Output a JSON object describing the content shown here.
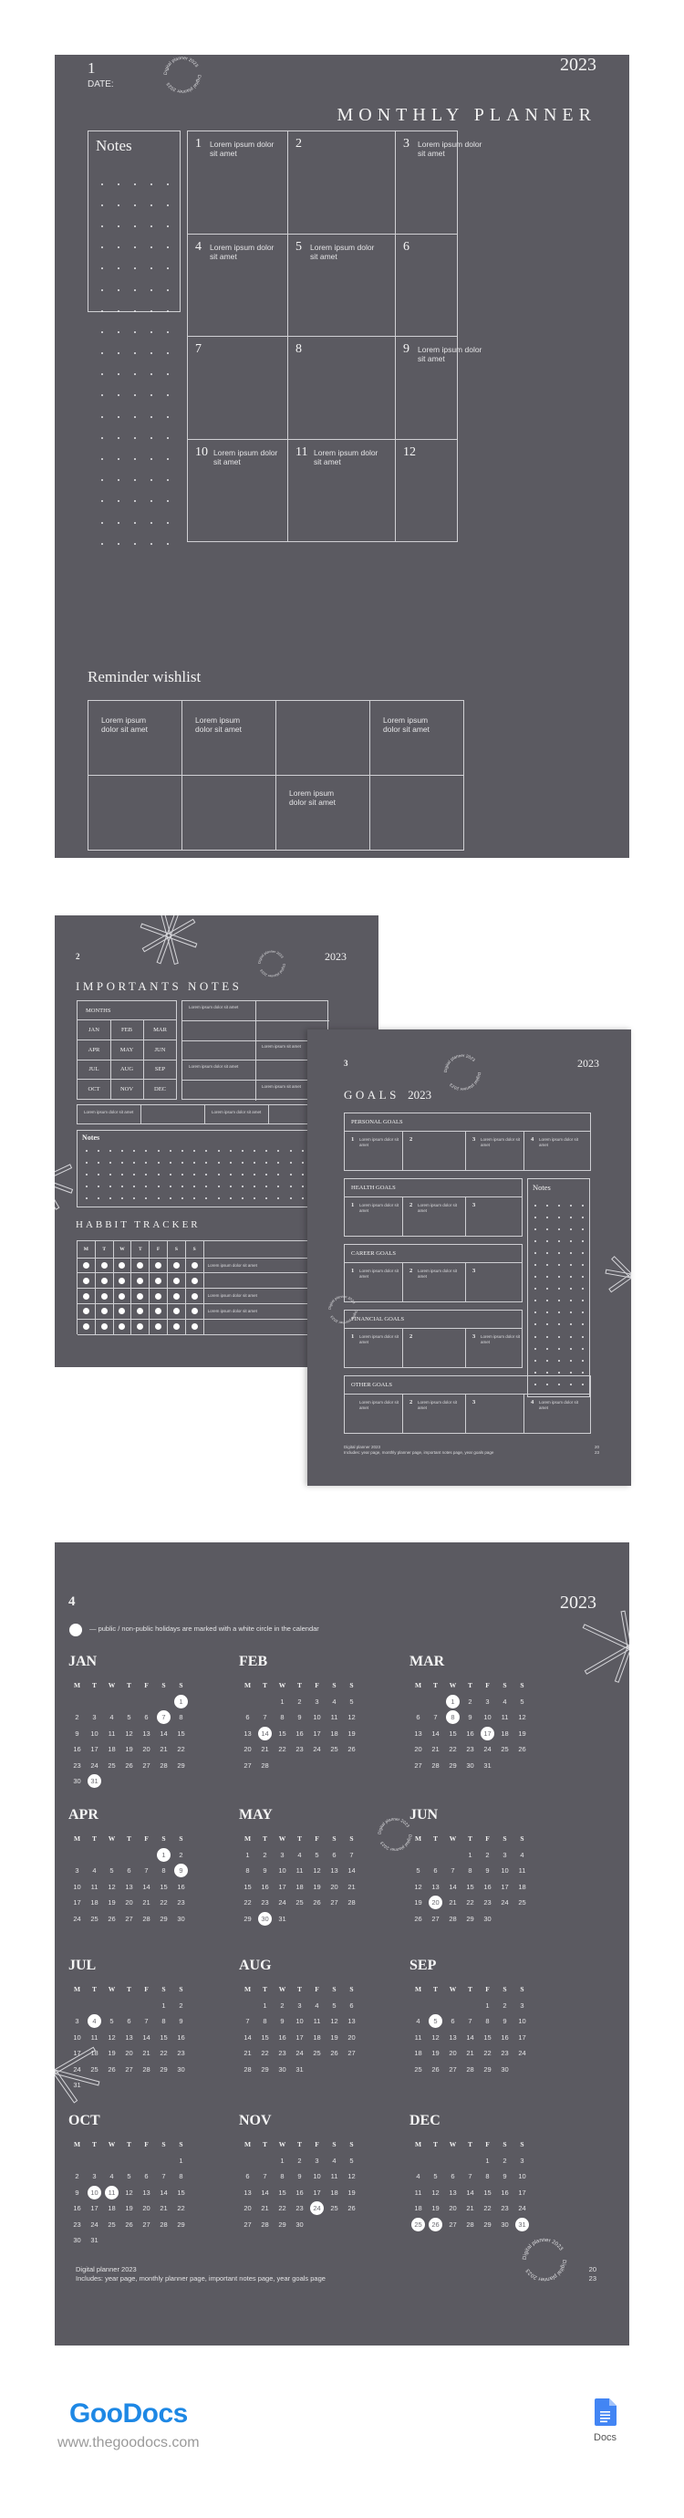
{
  "colors": {
    "page_bg": "#5b5a61",
    "line": "#d9d9dd",
    "text": "#f2f2f2",
    "holiday_circle": "#ffffff",
    "brand_blue": "#1e88e5",
    "docs_blue": "#4285f4"
  },
  "stamp_text": "Digital planner 2023",
  "lorem": "Lorem ipsum dolor sit amet",
  "page1": {
    "page_number": "1",
    "date_label": "DATE:",
    "year": "2023",
    "title": "MONTHLY PLANNER",
    "notes_title": "Notes",
    "months": [
      {
        "n": "1",
        "text": "Lorem ipsum dolor sit amet"
      },
      {
        "n": "2",
        "text": ""
      },
      {
        "n": "3",
        "text": "Lorem ipsum dolor sit amet"
      },
      {
        "n": "4",
        "text": "Lorem ipsum dolor sit amet"
      },
      {
        "n": "5",
        "text": "Lorem ipsum dolor sit amet"
      },
      {
        "n": "6",
        "text": ""
      },
      {
        "n": "7",
        "text": ""
      },
      {
        "n": "8",
        "text": ""
      },
      {
        "n": "9",
        "text": "Lorem ipsum dolor sit amet"
      },
      {
        "n": "10",
        "text": "Lorem ipsum dolor sit amet"
      },
      {
        "n": "11",
        "text": "Lorem ipsum dolor sit amet"
      },
      {
        "n": "12",
        "text": ""
      }
    ],
    "reminder_title": "Reminder wishlist",
    "reminders": [
      "Lorem ipsum dolor sit amet",
      "Lorem ipsum dolor sit amet",
      "",
      "Lorem ipsum dolor sit amet",
      "",
      "",
      "Lorem ipsum dolor sit amet",
      ""
    ]
  },
  "page2": {
    "page_number": "2",
    "year": "2023",
    "title": "IMPORTANTS NOTES",
    "months_header": "MONTHS",
    "months": [
      "JAN",
      "FEB",
      "MAR",
      "APR",
      "MAY",
      "JUN",
      "JUL",
      "AUG",
      "SEP",
      "OCT",
      "NOV",
      "DEC"
    ],
    "side_notes": [
      "Lorem ipsum dolor sit amet",
      "",
      "",
      "",
      "",
      "Lorem ipsum sit amet",
      "Lorem ipsum dolor sit amet",
      "",
      "",
      "Lorem ipsum sit amet"
    ],
    "bottom_notes": [
      "Lorem ipsum dolor sit amet",
      "",
      "Lorem ipsum dolor sit amet",
      ""
    ],
    "notes_title": "Notes",
    "habit_title": "HABBIT TRACKER",
    "habit_days": [
      "M",
      "T",
      "W",
      "T",
      "F",
      "S",
      "S"
    ],
    "habit_rows": [
      "Lorem ipsum dolor sit amet",
      "",
      "Lorem ipsum dolor sit amet",
      "Lorem ipsum dolor sit amet",
      ""
    ]
  },
  "page3": {
    "page_number": "3",
    "year": "2023",
    "title": "GOALS",
    "title_year": "2023",
    "notes_title": "Notes",
    "sections": [
      {
        "title": "PERSONAL GOALS",
        "items": [
          {
            "n": "1",
            "text": "Lorem ipsum dolor sit amet"
          },
          {
            "n": "2",
            "text": ""
          },
          {
            "n": "3",
            "text": "Lorem ipsum dolor sit amet"
          },
          {
            "n": "4",
            "text": "Lorem ipsum dolor sit amet"
          }
        ]
      },
      {
        "title": "HEALTH GOALS",
        "items": [
          {
            "n": "1",
            "text": "Lorem ipsum dolor sit amet"
          },
          {
            "n": "2",
            "text": "Lorem ipsum dolor sit amet"
          },
          {
            "n": "3",
            "text": ""
          }
        ]
      },
      {
        "title": "CAREER GOALS",
        "items": [
          {
            "n": "1",
            "text": "Lorem ipsum dolor sit amet"
          },
          {
            "n": "2",
            "text": "Lorem ipsum dolor sit amet"
          },
          {
            "n": "3",
            "text": ""
          }
        ]
      },
      {
        "title": "FINANCIAL GOALS",
        "items": [
          {
            "n": "1",
            "text": "Lorem ipsum dolor sit amet"
          },
          {
            "n": "2",
            "text": ""
          },
          {
            "n": "3",
            "text": "Lorem ipsum dolor sit amet"
          }
        ]
      },
      {
        "title": "OTHER GOALS",
        "items": [
          {
            "n": "",
            "text": "Lorem ipsum dolor sit amet"
          },
          {
            "n": "2",
            "text": "Lorem ipsum dolor sit amet"
          },
          {
            "n": "3",
            "text": ""
          },
          {
            "n": "4",
            "text": "Lorem ipsum dolor sit amet"
          }
        ]
      }
    ],
    "footer_line1": "Digital planner 2023",
    "footer_line2": "Includes: year page, monthly planner page, important notes page, year goals page",
    "footer_year_top": "20",
    "footer_year_bottom": "23"
  },
  "page4": {
    "page_number": "4",
    "year": "2023",
    "legend": "— public / non-public holidays are marked with a white circle in the calendar",
    "weekdays": [
      "M",
      "T",
      "W",
      "T",
      "F",
      "S",
      "S"
    ],
    "months": [
      {
        "name": "JAN",
        "offset": 6,
        "days": 31,
        "holidays": [
          1,
          7,
          31
        ]
      },
      {
        "name": "FEB",
        "offset": 2,
        "days": 28,
        "holidays": [
          14
        ]
      },
      {
        "name": "MAR",
        "offset": 2,
        "days": 31,
        "holidays": [
          1,
          8,
          17
        ]
      },
      {
        "name": "APR",
        "offset": 5,
        "days": 30,
        "holidays": [
          1,
          9
        ]
      },
      {
        "name": "MAY",
        "offset": 0,
        "days": 31,
        "holidays": [
          30
        ]
      },
      {
        "name": "JUN",
        "offset": 3,
        "days": 30,
        "holidays": [
          20
        ]
      },
      {
        "name": "JUL",
        "offset": 5,
        "days": 31,
        "holidays": [
          4
        ]
      },
      {
        "name": "AUG",
        "offset": 1,
        "days": 31,
        "holidays": []
      },
      {
        "name": "SEP",
        "offset": 4,
        "days": 30,
        "holidays": [
          5
        ]
      },
      {
        "name": "OCT",
        "offset": 6,
        "days": 31,
        "holidays": [
          10,
          11
        ]
      },
      {
        "name": "NOV",
        "offset": 2,
        "days": 30,
        "holidays": [
          24
        ]
      },
      {
        "name": "DEC",
        "offset": 4,
        "days": 31,
        "holidays": [
          25,
          26,
          31
        ]
      }
    ],
    "footer_line1": "Digital planner 2023",
    "footer_line2": "Includes: year page, monthly planner page, important notes page, year goals page",
    "footer_year_top": "20",
    "footer_year_bottom": "23"
  },
  "branding": {
    "logo": "GooDocs",
    "url": "www.thegoodocs.com",
    "docs_label": "Docs"
  }
}
